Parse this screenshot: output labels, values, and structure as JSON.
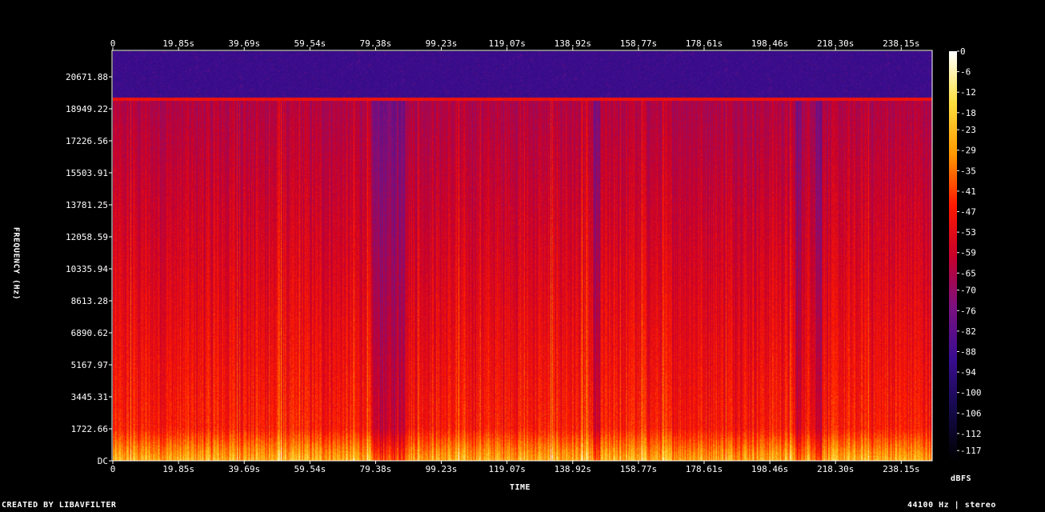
{
  "chart_data": {
    "type": "heatmap",
    "title": "",
    "xlabel": "TIME",
    "ylabel": "FREQUENCY (Hz)",
    "x_ticks": [
      "0",
      "19.85s",
      "39.69s",
      "59.54s",
      "79.38s",
      "99.23s",
      "119.07s",
      "138.92s",
      "158.77s",
      "178.61s",
      "198.46s",
      "218.30s",
      "238.15s"
    ],
    "x_tick_values": [
      0,
      19.85,
      39.69,
      59.54,
      79.38,
      99.23,
      119.07,
      138.92,
      158.77,
      178.61,
      198.46,
      218.3,
      238.15
    ],
    "x_range": [
      0,
      247.5
    ],
    "y_ticks": [
      "DC",
      "1722.66",
      "3445.31",
      "5167.97",
      "6890.62",
      "8613.28",
      "10335.94",
      "12058.59",
      "13781.25",
      "15503.91",
      "17226.56",
      "18949.22",
      "20671.88"
    ],
    "y_tick_values": [
      0,
      1722.66,
      3445.31,
      5167.97,
      6890.62,
      8613.28,
      10335.94,
      12058.59,
      13781.25,
      15503.91,
      17226.56,
      18949.22,
      20671.88
    ],
    "y_range": [
      0,
      22050
    ],
    "lowpass_cutoff_hz": 19500,
    "quiet_segments_s": [
      [
        78,
        88
      ],
      [
        145,
        147
      ],
      [
        206,
        208
      ],
      [
        212,
        214
      ]
    ],
    "colorbar": {
      "label": "dBFS",
      "ticks": [
        "0",
        "-6",
        "-12",
        "-18",
        "-23",
        "-29",
        "-35",
        "-41",
        "-47",
        "-53",
        "-59",
        "-65",
        "-70",
        "-76",
        "-82",
        "-88",
        "-94",
        "-100",
        "-106",
        "-112",
        "-117"
      ],
      "min": -120,
      "max": 0,
      "colors": [
        "#ffffff",
        "#ffe040",
        "#ff9a00",
        "#ff1a00",
        "#c8002a",
        "#7a1080",
        "#3a0d90",
        "#140a4a",
        "#000000"
      ]
    }
  },
  "footer": {
    "left": "CREATED BY LIBAVFILTER",
    "right": "44100 Hz | stereo"
  }
}
